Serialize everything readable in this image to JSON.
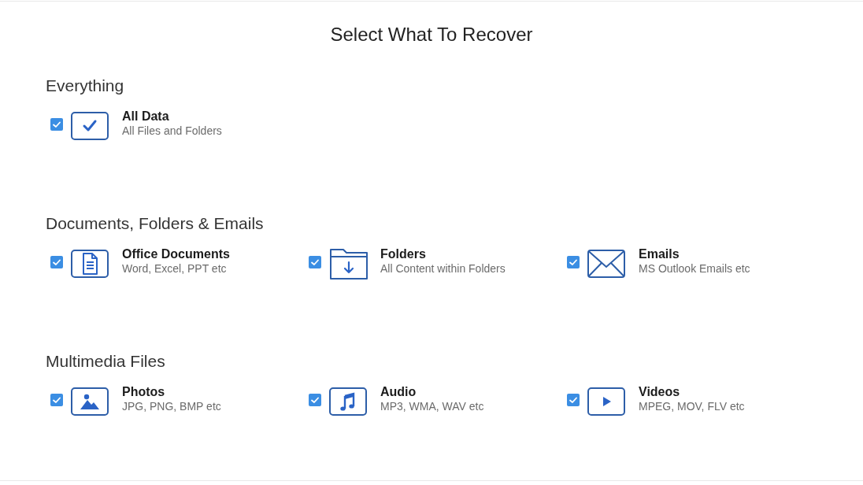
{
  "title": "Select What To Recover",
  "sections": [
    {
      "heading": "Everything",
      "items": [
        {
          "kind": "all",
          "label": "All Data",
          "description": "All Files and Folders",
          "checked": true
        }
      ]
    },
    {
      "heading": "Documents, Folders & Emails",
      "items": [
        {
          "kind": "documents",
          "label": "Office Documents",
          "description": "Word, Excel, PPT etc",
          "checked": true
        },
        {
          "kind": "folders",
          "label": "Folders",
          "description": "All Content within Folders",
          "checked": true
        },
        {
          "kind": "emails",
          "label": "Emails",
          "description": "MS Outlook Emails etc",
          "checked": true
        }
      ]
    },
    {
      "heading": "Multimedia Files",
      "items": [
        {
          "kind": "photos",
          "label": "Photos",
          "description": "JPG, PNG, BMP etc",
          "checked": true
        },
        {
          "kind": "audio",
          "label": "Audio",
          "description": "MP3, WMA, WAV etc",
          "checked": true
        },
        {
          "kind": "videos",
          "label": "Videos",
          "description": "MPEG, MOV, FLV etc",
          "checked": true
        }
      ]
    }
  ]
}
